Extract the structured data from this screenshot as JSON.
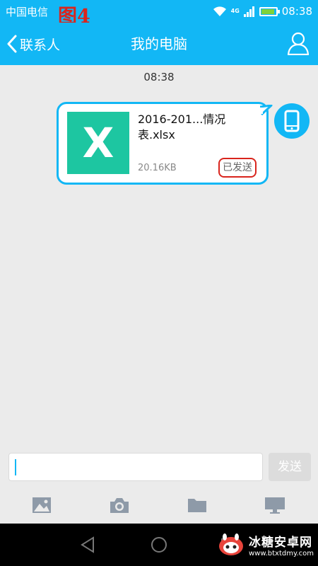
{
  "status_bar": {
    "carrier": "中国电信",
    "network": "4G",
    "time": "08:38",
    "battery_level": 0.9,
    "battery_color": "#7fd23a"
  },
  "annotation": {
    "figure_label": "图4",
    "color": "#d9251d"
  },
  "header": {
    "back_label": "联系人",
    "title": "我的电脑",
    "right_icon": "profile-icon",
    "background": "#12b7f5"
  },
  "chat": {
    "timestamp": "08:38",
    "messages": [
      {
        "direction": "outgoing",
        "type": "file",
        "file_icon": "excel-icon",
        "file_icon_letter": "X",
        "file_name": "2016-201...情况表.xlsx",
        "file_size": "20.16KB",
        "status": "已发送",
        "sender_avatar": "phone-icon"
      }
    ]
  },
  "composer": {
    "input_value": "",
    "input_placeholder": "",
    "send_label": "发送"
  },
  "toolbar": {
    "items": [
      "image-icon",
      "camera-icon",
      "folder-icon",
      "computer-icon"
    ]
  },
  "system_nav": {
    "items": [
      "back-triangle-icon",
      "home-circle-icon",
      "recents-square-icon"
    ]
  },
  "watermark": {
    "title": "冰糖安卓网",
    "url": "www.btxtdmy.com"
  }
}
